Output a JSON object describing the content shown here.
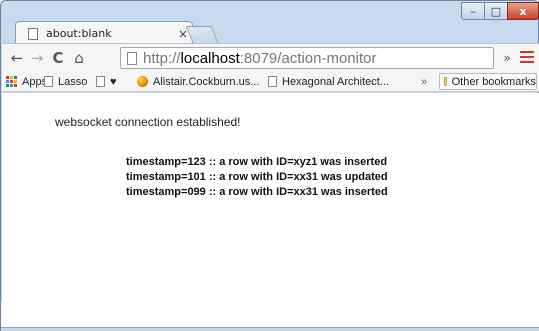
{
  "tab": {
    "title": "about:blank",
    "close_glyph": "×"
  },
  "window_controls": {
    "minimize": "–",
    "maximize": "□",
    "close": "x"
  },
  "toolbar": {
    "url_protocol": "http://",
    "url_host": "localhost",
    "url_rest": ":8079/action-monitor",
    "extensions_label": "»"
  },
  "bookmarks": {
    "apps": "Apps",
    "lasso": "Lasso",
    "heart": "♥",
    "alistair": "Alistair.Cockburn.us...",
    "hexagonal": "Hexagonal Architect...",
    "more": "»",
    "other": "Other bookmarks"
  },
  "page": {
    "status": "websocket connection established!",
    "events": [
      "timestamp=123 :: a row with ID=xyz1 was inserted",
      "timestamp=101 :: a row with ID=xx31 was updated",
      "timestamp=099 :: a row with ID=xx31 was inserted"
    ]
  },
  "colors": {
    "menu_accent": "#d5352f",
    "close_button": "#c7432a",
    "frame": "#b7cde8"
  }
}
